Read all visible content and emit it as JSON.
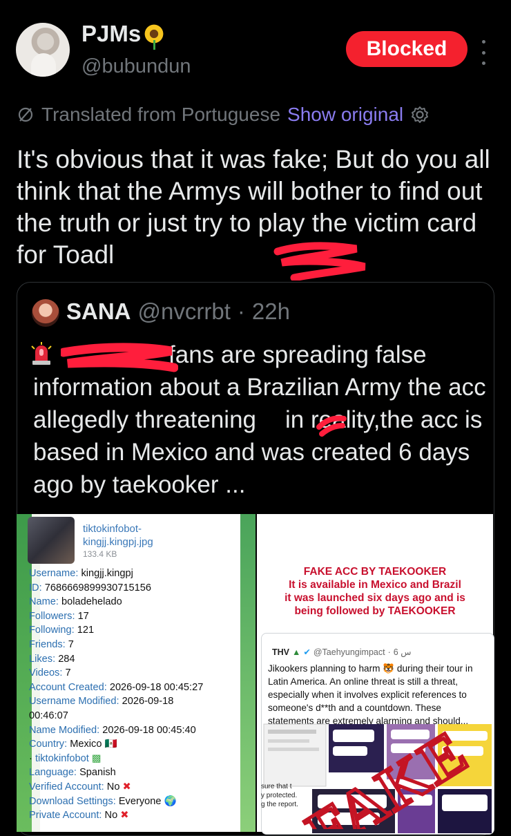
{
  "author": {
    "display_name": "PJMs",
    "handle": "@bubundun",
    "name_emoji": "sunflower-emoji",
    "avatar": "avatar-image"
  },
  "actions": {
    "blocked_label": "Blocked",
    "more_icon": "more-options-icon"
  },
  "translation": {
    "label": "Translated from Portuguese",
    "show_original": "Show original",
    "settings_icon": "gear-icon",
    "translate_icon": "translate-icon"
  },
  "tweet": {
    "text": "It's obvious that it was fake; But do you all think that the Armys will bother to find out the truth or just try to play the victim card for Toadl"
  },
  "quote": {
    "name": "SANA",
    "handle": "@nvcrrbt",
    "separator": "·",
    "time": "22h",
    "prefix_emoji": "police-siren-emoji",
    "text_line1": "fans are spreading false information about a Brazilian Army the acc allegedly threatening",
    "text_line2": "in reality,the acc is based in Mexico and was created 6 days ago by taekooker ..."
  },
  "telegram_card": {
    "file_name": "tiktokinfobot-kingjj.kingpj.jpg",
    "file_size": "133.4 KB",
    "rows": [
      {
        "label": "Username:",
        "value": "kingjj.kingpj"
      },
      {
        "label": "ID:",
        "value": "7686669899930715156"
      },
      {
        "label": "Name:",
        "value": "boladehelado"
      },
      {
        "label": "Followers:",
        "value": "17"
      },
      {
        "label": "Following:",
        "value": "121"
      },
      {
        "label": "Friends:",
        "value": "7"
      },
      {
        "label": "Likes:",
        "value": "284"
      },
      {
        "label": "Videos:",
        "value": "7"
      },
      {
        "label": "Account Created:",
        "value": "2026-09-18 00:45:27"
      },
      {
        "label": "Username Modified:",
        "value": "2026-09-18"
      },
      {
        "label": "",
        "value": "00:46:07"
      },
      {
        "label": "Name Modified:",
        "value": "2026-09-18 00:45:40"
      },
      {
        "label": "Country:",
        "value": "Mexico 🇲🇽"
      },
      {
        "label": "·",
        "value": "tiktokinfobot"
      },
      {
        "label": "Language:",
        "value": "Spanish"
      },
      {
        "label": "Verified Account:",
        "value": "No"
      },
      {
        "label": "Download Settings:",
        "value": "Everyone 🌍"
      },
      {
        "label": "Private Account:",
        "value": "No"
      }
    ]
  },
  "fake_card": {
    "title_lines": [
      "FAKE ACC BY TAEKOOKER",
      "It is available in Mexico and Brazil",
      "it was launched six days ago and is",
      "being followed by TAEKOOKER"
    ],
    "thv_name": "THV",
    "thv_handle": "@Taehyungimpact",
    "thv_time": "6 س",
    "thv_text": "Jikookers planning to harm 🐯 during their tour in Latin America. An online threat is still a threat, especially when it involves explicit references to someone's d**th and a countdown. These statements are extremely alarming and should...",
    "stamp": "FAKE",
    "side_text": [
      "sure that t",
      "y protected.",
      "g the report."
    ]
  }
}
